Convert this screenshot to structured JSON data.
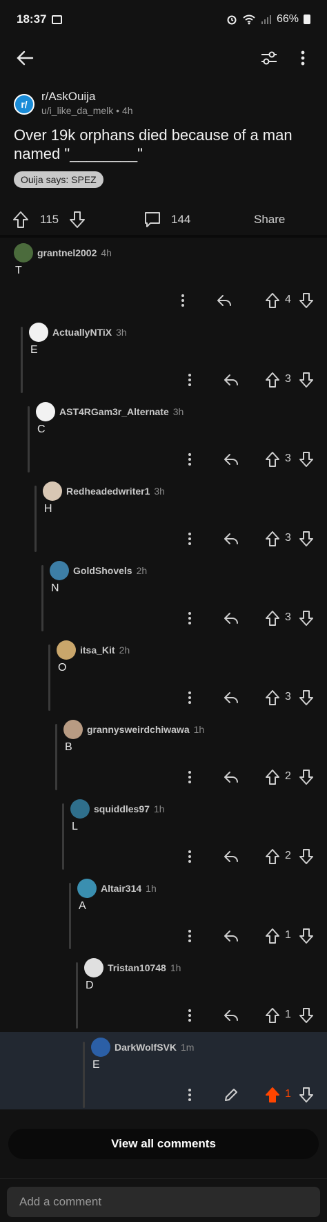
{
  "status_bar": {
    "time": "18:37",
    "battery": "66%"
  },
  "post": {
    "subreddit": "r/AskOuija",
    "author": "u/i_like_da_melk",
    "age": "4h",
    "title": "Over 19k orphans died because of a man named \"________\"",
    "flair": "Ouija says: SPEZ",
    "upvotes": "115",
    "comments": "144",
    "share_label": "Share"
  },
  "comments": [
    {
      "author": "grantnel2002",
      "age": "4h",
      "body": "T",
      "votes": "4",
      "avatar_color": "#4b6b3c"
    },
    {
      "author": "ActuallyNTiX",
      "age": "3h",
      "body": "E",
      "votes": "3",
      "avatar_color": "#f2f2f2"
    },
    {
      "author": "AST4RGam3r_Alternate",
      "age": "3h",
      "body": "C",
      "votes": "3",
      "avatar_color": "#f2f2f2"
    },
    {
      "author": "Redheadedwriter1",
      "age": "3h",
      "body": "H",
      "votes": "3",
      "avatar_color": "#d8c7b4"
    },
    {
      "author": "GoldShovels",
      "age": "2h",
      "body": "N",
      "votes": "3",
      "avatar_color": "#3d7ea6"
    },
    {
      "author": "itsa_Kit",
      "age": "2h",
      "body": "O",
      "votes": "3",
      "avatar_color": "#c9a66b"
    },
    {
      "author": "grannysweirdchiwawa",
      "age": "1h",
      "body": "B",
      "votes": "2",
      "avatar_color": "#b89b83"
    },
    {
      "author": "squiddles97",
      "age": "1h",
      "body": "L",
      "votes": "2",
      "avatar_color": "#2f6f8c"
    },
    {
      "author": "Altair314",
      "age": "1h",
      "body": "A",
      "votes": "1",
      "avatar_color": "#3a8fb0"
    },
    {
      "author": "Tristan10748",
      "age": "1h",
      "body": "D",
      "votes": "1",
      "avatar_color": "#e0e0e0"
    },
    {
      "author": "DarkWolfSVK",
      "age": "1m",
      "body": "E",
      "votes": "1",
      "avatar_color": "#2b5fa6"
    }
  ],
  "view_all_label": "View all comments",
  "add_comment_placeholder": "Add a comment",
  "colors": {
    "upvoted": "#ff4500",
    "background": "#121212",
    "highlight": "#222831"
  }
}
